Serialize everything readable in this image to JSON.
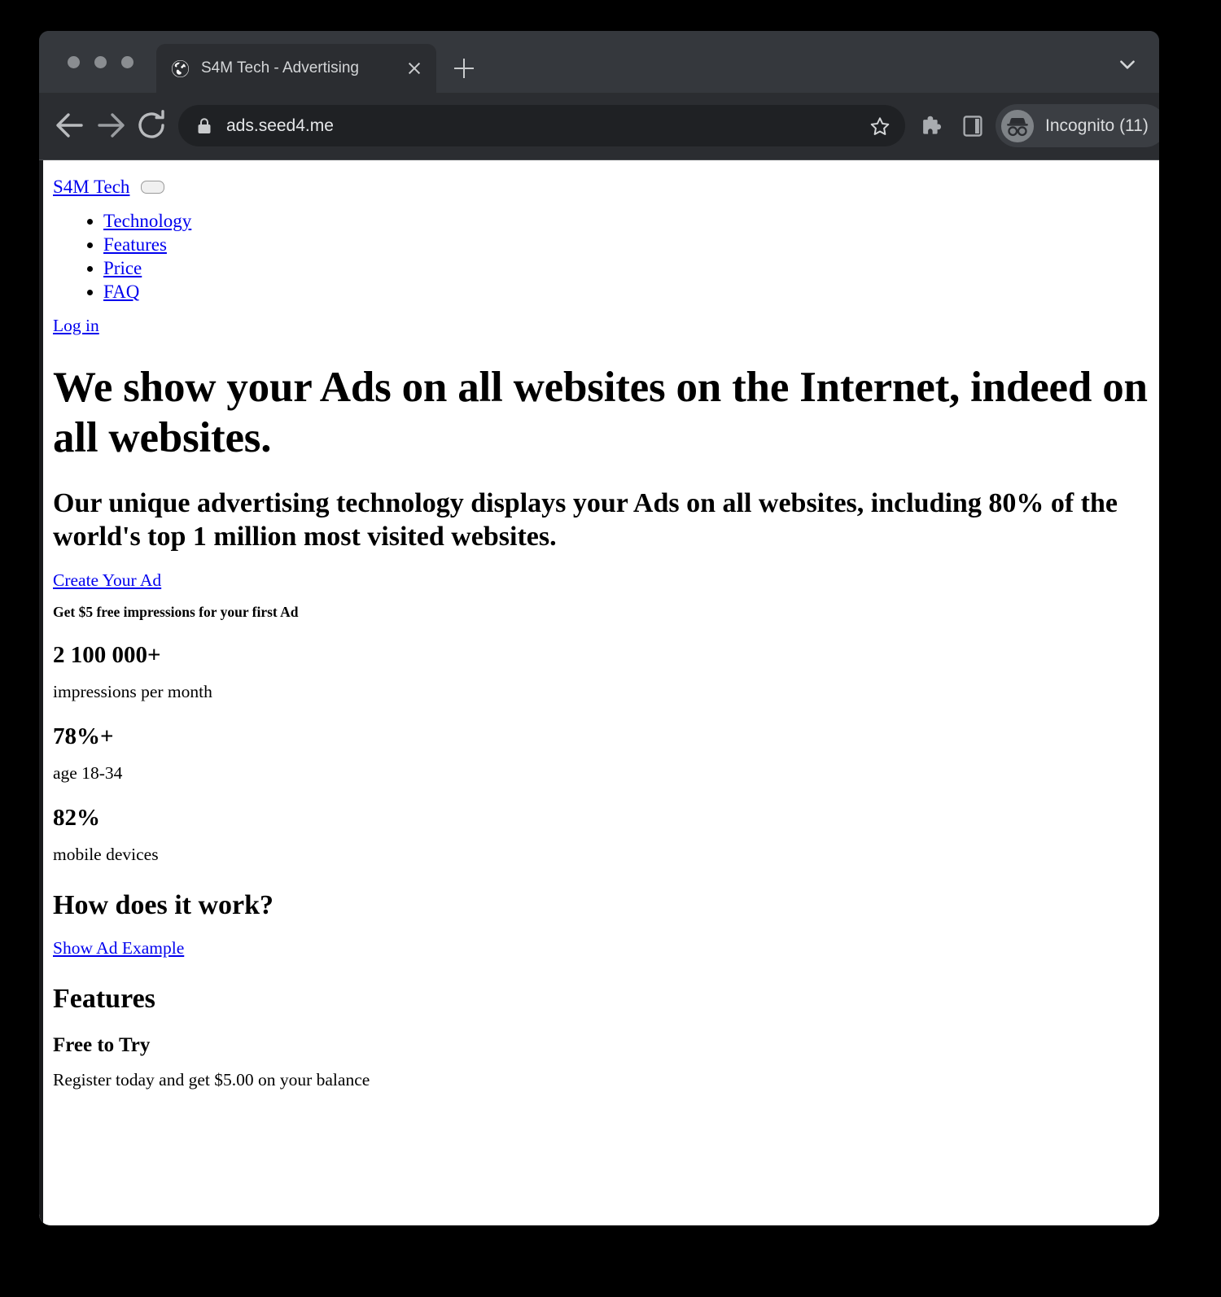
{
  "browser": {
    "tab": {
      "title": "S4M Tech - Advertising",
      "favicon": "globe-icon",
      "close_icon": "close-icon"
    },
    "new_tab_icon": "plus-icon",
    "tabstrip_chevron_icon": "chevron-down-icon",
    "toolbar": {
      "back_icon": "arrow-left-icon",
      "forward_icon": "arrow-right-icon",
      "reload_icon": "reload-icon",
      "lock_icon": "lock-icon",
      "url": "ads.seed4.me",
      "bookmark_icon": "star-icon",
      "extensions_icon": "puzzle-piece-icon",
      "sidepanel_icon": "side-panel-icon",
      "profile_avatar_icon": "incognito-hat-icon",
      "profile_label": "Incognito (11)",
      "menu_icon": "three-dots-vertical-icon"
    },
    "colors": {
      "tabstrip_bg": "#35383d",
      "toolbar_bg": "#2b2d31",
      "omnibox_bg": "#1f2124",
      "chrome_text": "#d4d6d8",
      "page_bg": "#ffffff",
      "link": "#0000ee"
    }
  },
  "page": {
    "brand": "S4M Tech",
    "navbar_toggle_label": "",
    "nav_items": [
      {
        "label": "Technology"
      },
      {
        "label": "Features"
      },
      {
        "label": "Price"
      },
      {
        "label": "FAQ"
      }
    ],
    "login_link": "Log in",
    "hero_heading": "We show your Ads on all websites on the Internet, indeed on all websites.",
    "hero_subheading": "Our unique advertising technology displays your Ads on all websites, including 80% of the world's top 1 million most visited websites.",
    "cta_link": "Create Your Ad",
    "cta_note": "Get $5 free impressions for your first Ad",
    "stats": [
      {
        "value": "2 100 000+",
        "label": "impressions per month"
      },
      {
        "value": "78%+",
        "label": "age 18-34"
      },
      {
        "value": "82%",
        "label": "mobile devices"
      }
    ],
    "how_heading": "How does it work?",
    "show_example_link": "Show Ad Example",
    "features_heading": "Features",
    "feature_items": [
      {
        "title": "Free to Try",
        "text": "Register today and get $5.00 on your balance"
      }
    ]
  }
}
